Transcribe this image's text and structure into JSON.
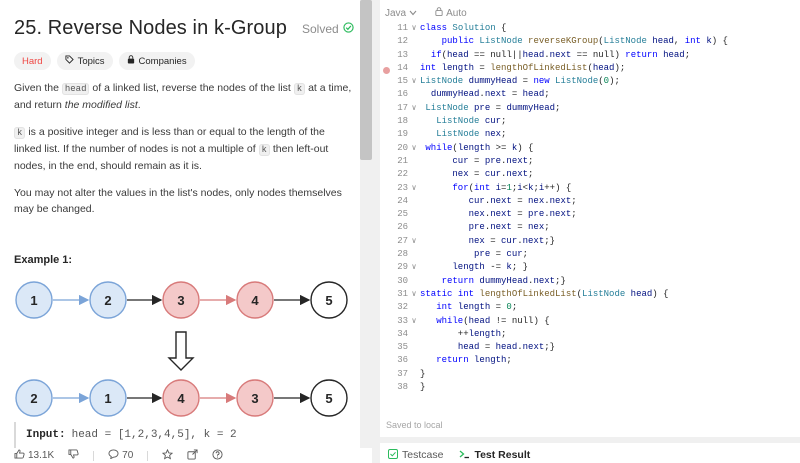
{
  "problem": {
    "title": "25. Reverse Nodes in k-Group",
    "solved_label": "Solved",
    "tags": {
      "difficulty": "Hard",
      "topics": "Topics",
      "companies": "Companies"
    },
    "desc": {
      "p1_a": "Given the ",
      "p1_code": "head",
      "p1_b": " of a linked list, reverse the nodes of the list ",
      "p1_code2": "k",
      "p1_c": " at a time, and return ",
      "p1_em": "the modified list",
      "p1_d": ".",
      "p2_code": "k",
      "p2_a": " is a positive integer and is less than or equal to the length of the linked list. If the number of nodes is not a multiple of ",
      "p2_code2": "k",
      "p2_b": " then left-out nodes, in the end, should remain as it is.",
      "p3": "You may not alter the values in the list's nodes, only nodes themselves may be changed."
    },
    "example_heading": "Example 1:",
    "diagram": {
      "row1": [
        "1",
        "2",
        "3",
        "4",
        "5"
      ],
      "row2": [
        "2",
        "1",
        "4",
        "3",
        "5"
      ]
    },
    "input_label": "Input:",
    "input_value": "head = [1,2,3,4,5], k = 2",
    "footer": {
      "likes": "13.1K",
      "comments": "70"
    }
  },
  "editor": {
    "language": "Java",
    "mode": "Auto",
    "saved_status": "Saved to local",
    "console_tabs": [
      "Testcase",
      "Test Result"
    ],
    "lines": [
      {
        "n": "11",
        "f": "v",
        "t": "class Solution {"
      },
      {
        "n": "12",
        "f": "",
        "t": "    public ListNode reverseKGroup(ListNode head, int k) {"
      },
      {
        "n": "13",
        "f": "",
        "t": "  if(head == null||head.next == null) return head;"
      },
      {
        "n": "14",
        "f": "",
        "t": "int length = lengthOfLinkedList(head);"
      },
      {
        "n": "15",
        "f": "v",
        "t": "ListNode dummyHead = new ListNode(0);"
      },
      {
        "n": "16",
        "f": "",
        "t": "  dummyHead.next = head;"
      },
      {
        "n": "17",
        "f": "v",
        "t": " ListNode pre = dummyHead;"
      },
      {
        "n": "18",
        "f": "",
        "t": "   ListNode cur;"
      },
      {
        "n": "19",
        "f": "",
        "t": "   ListNode nex;"
      },
      {
        "n": "20",
        "f": "v",
        "t": " while(length >= k) {"
      },
      {
        "n": "21",
        "f": "",
        "t": "      cur = pre.next;"
      },
      {
        "n": "22",
        "f": "",
        "t": "      nex = cur.next;"
      },
      {
        "n": "23",
        "f": "v",
        "t": "      for(int i=1;i<k;i++) {"
      },
      {
        "n": "24",
        "f": "",
        "t": "         cur.next = nex.next;"
      },
      {
        "n": "25",
        "f": "",
        "t": "         nex.next = pre.next;"
      },
      {
        "n": "26",
        "f": "",
        "t": "         pre.next = nex;"
      },
      {
        "n": "27",
        "f": "v",
        "t": "         nex = cur.next;}"
      },
      {
        "n": "28",
        "f": "",
        "t": "          pre = cur;"
      },
      {
        "n": "29",
        "f": "v",
        "t": "      length -= k; }"
      },
      {
        "n": "30",
        "f": "",
        "t": "    return dummyHead.next;}"
      },
      {
        "n": "31",
        "f": "v",
        "t": "static int lengthOfLinkedList(ListNode head) {"
      },
      {
        "n": "32",
        "f": "",
        "t": "   int length = 0;"
      },
      {
        "n": "33",
        "f": "v",
        "t": "   while(head != null) {"
      },
      {
        "n": "34",
        "f": "",
        "t": "       ++length;"
      },
      {
        "n": "35",
        "f": "",
        "t": "       head = head.next;}"
      },
      {
        "n": "36",
        "f": "",
        "t": "   return length;"
      },
      {
        "n": "37",
        "f": "",
        "t": "}"
      },
      {
        "n": "38",
        "f": "",
        "t": "}"
      }
    ]
  },
  "colors": {
    "accent_green": "#2cbb5d",
    "hard_red": "#ef4743",
    "node_blue_fill": "#dbe8f7",
    "node_blue_stroke": "#7ba4d8",
    "node_red_fill": "#f4c9c9",
    "node_red_stroke": "#d87a7a"
  }
}
